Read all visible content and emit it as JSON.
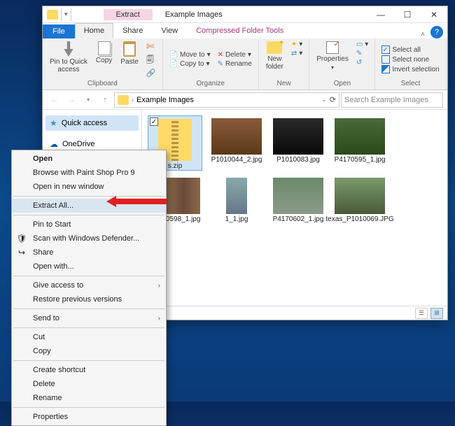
{
  "window": {
    "contextualTab": "Extract",
    "contextualGroup": "Compressed Folder Tools",
    "title": "Example Images"
  },
  "tabs": {
    "file": "File",
    "home": "Home",
    "share": "Share",
    "view": "View"
  },
  "ribbon": {
    "pin": "Pin to Quick\naccess",
    "copy": "Copy",
    "paste": "Paste",
    "moveTo": "Move to",
    "copyTo": "Copy to",
    "delete": "Delete",
    "rename": "Rename",
    "newFolder": "New\nfolder",
    "properties": "Properties",
    "selectAll": "Select all",
    "selectNone": "Select none",
    "invert": "Invert selection",
    "groupClipboard": "Clipboard",
    "groupOrganize": "Organize",
    "groupNew": "New",
    "groupOpen": "Open",
    "groupSelect": "Select"
  },
  "address": {
    "folder": "Example Images",
    "searchPlaceholder": "Search Example Images"
  },
  "nav": {
    "quick": "Quick access",
    "onedrive": "OneDrive"
  },
  "files": {
    "zip": "s.zip",
    "f1": "P1010044_2.jpg",
    "f2": "P1010083.jpg",
    "f3": "P4170595_1.jpg",
    "f4": "P4170598_1.jpg",
    "f5": "1_1.jpg",
    "f6": "P4170602_1.jpg",
    "f7": "texas_P1010069.JPG"
  },
  "menu": {
    "open": "Open",
    "browsePSP": "Browse with Paint Shop Pro 9",
    "newWindow": "Open in new window",
    "extractAll": "Extract All...",
    "pinStart": "Pin to Start",
    "defender": "Scan with Windows Defender...",
    "share": "Share",
    "openWith": "Open with...",
    "giveAccess": "Give access to",
    "restore": "Restore previous versions",
    "sendTo": "Send to",
    "cut": "Cut",
    "copy": "Copy",
    "shortcut": "Create shortcut",
    "delete": "Delete",
    "rename": "Rename",
    "properties": "Properties"
  }
}
